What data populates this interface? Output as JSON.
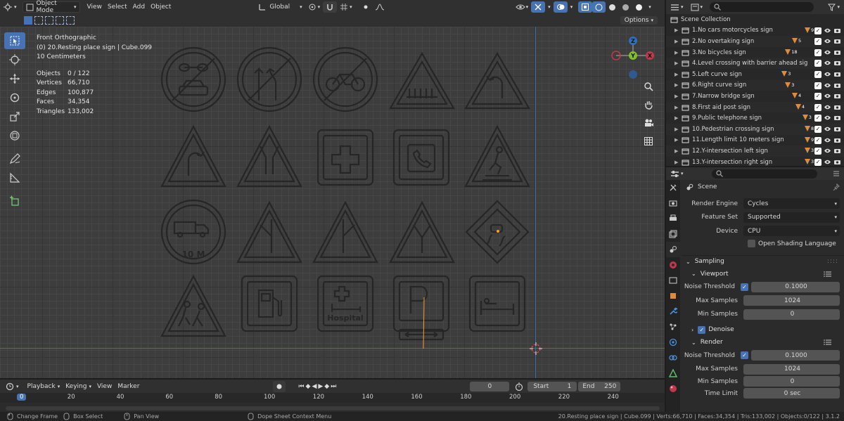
{
  "header": {
    "mode": "Object Mode",
    "menus": [
      "View",
      "Select",
      "Add",
      "Object"
    ],
    "orientation": "Global",
    "options": "Options"
  },
  "overlay": {
    "view_name": "Front Orthographic",
    "active": "(0) 20.Resting place sign | Cube.099",
    "scale": "10 Centimeters",
    "stats": [
      {
        "k": "Objects",
        "v": "0 / 122"
      },
      {
        "k": "Vertices",
        "v": "66,710"
      },
      {
        "k": "Edges",
        "v": "100,877"
      },
      {
        "k": "Faces",
        "v": "34,354"
      },
      {
        "k": "Triangles",
        "v": "133,002"
      }
    ]
  },
  "signs_text": {
    "limit": "10 M",
    "hospital": "Hospital"
  },
  "gizmo": {
    "x": "X",
    "y": "Y",
    "z": "Z"
  },
  "outliner": {
    "root": "Scene Collection",
    "items": [
      {
        "label": "1.No cars motorcycles sign",
        "count": "9"
      },
      {
        "label": "2.No overtaking sign",
        "count": "5"
      },
      {
        "label": "3.No bicycles sign",
        "count": "18"
      },
      {
        "label": "4.Level crossing with barrier ahead sig",
        "count": ""
      },
      {
        "label": "5.Left curve sign",
        "count": "3"
      },
      {
        "label": "6.Right curve sign",
        "count": "3"
      },
      {
        "label": "7.Narrow bridge sign",
        "count": "4"
      },
      {
        "label": "8.First aid post sign",
        "count": "4"
      },
      {
        "label": "9.Public telephone sign",
        "count": "3"
      },
      {
        "label": "10.Pedestrian crossing sign",
        "count": "8"
      },
      {
        "label": "11.Length limit 10 meters sign",
        "count": "9"
      },
      {
        "label": "12.Y-intersection left sign",
        "count": "3"
      },
      {
        "label": "13.Y-intersection right sign",
        "count": "3"
      }
    ]
  },
  "properties": {
    "context": "Scene",
    "render_engine_label": "Render Engine",
    "render_engine": "Cycles",
    "feature_set_label": "Feature Set",
    "feature_set": "Supported",
    "device_label": "Device",
    "device": "CPU",
    "osl": "Open Shading Language",
    "sampling": "Sampling",
    "viewport": "Viewport",
    "vp_noise_label": "Noise Threshold",
    "vp_noise": "0.1000",
    "vp_max_label": "Max Samples",
    "vp_max": "1024",
    "vp_min_label": "Min Samples",
    "vp_min": "0",
    "denoise": "Denoise",
    "render": "Render",
    "r_noise_label": "Noise Threshold",
    "r_noise": "0.1000",
    "r_max_label": "Max Samples",
    "r_max": "1024",
    "r_min_label": "Min Samples",
    "r_min": "0",
    "time_limit_label": "Time Limit",
    "time_limit": "0 sec"
  },
  "timeline": {
    "menus": [
      "Playback",
      "Keying",
      "View",
      "Marker"
    ],
    "current": "0",
    "start_label": "Start",
    "start": "1",
    "end_label": "End",
    "end": "250",
    "ticks": [
      "0",
      "20",
      "40",
      "60",
      "80",
      "100",
      "120",
      "140",
      "160",
      "180",
      "200",
      "220",
      "240"
    ]
  },
  "status": {
    "change_frame": "Change Frame",
    "box_select": "Box Select",
    "pan_view": "Pan View",
    "context_menu": "Dope Sheet Context Menu",
    "info": "20.Resting place sign | Cube.099 | Verts:66,710 | Faces:34,354 | Tris:133,002 | Objects:0/122 | 3.1.2"
  },
  "colors": {
    "accent": "#4772b3",
    "x_axis": "#c0394b",
    "z_axis": "#2f6fc0",
    "y_axis": "#7fbf2a",
    "count_badge": "#e08a3c"
  }
}
